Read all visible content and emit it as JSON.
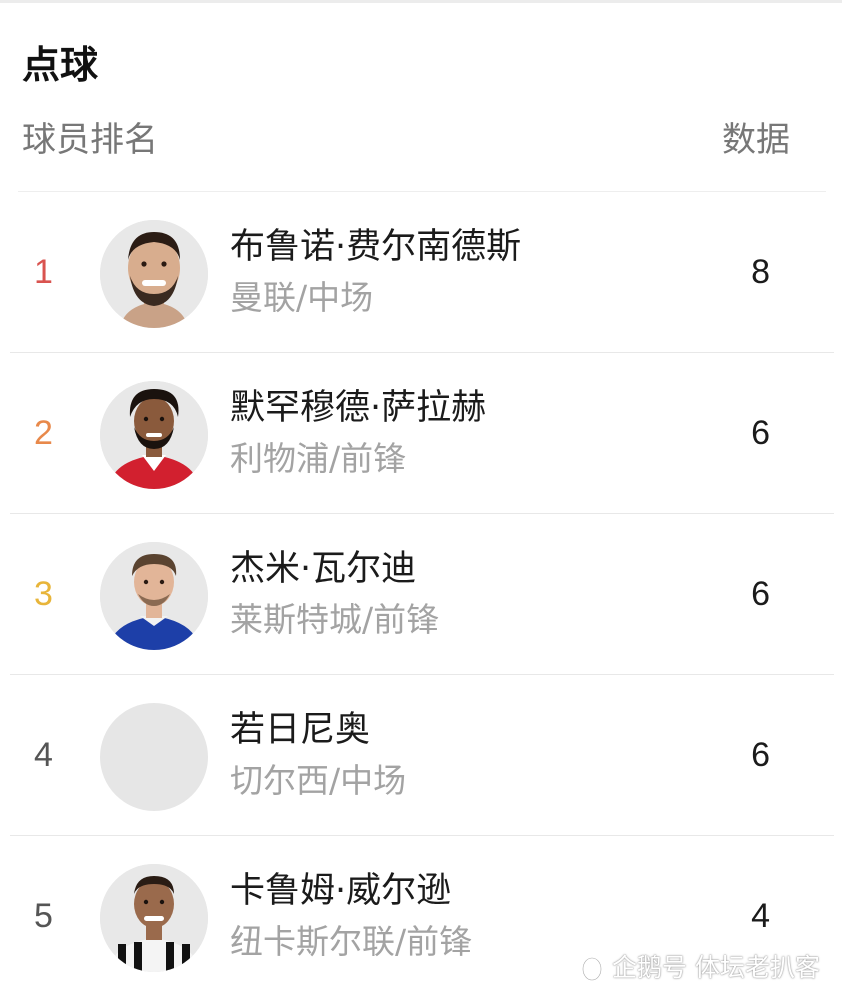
{
  "page": {
    "title": "点球",
    "header_rank": "球员排名",
    "header_data": "数据"
  },
  "players": [
    {
      "rank": "1",
      "name": "布鲁诺·费尔南德斯",
      "team": "曼联/中场",
      "value": "8",
      "rank_color": "#d9534f",
      "avatar": "player-photo-bruno"
    },
    {
      "rank": "2",
      "name": "默罕穆德·萨拉赫",
      "team": "利物浦/前锋",
      "value": "6",
      "rank_color": "#e8894b",
      "avatar": "player-photo-salah"
    },
    {
      "rank": "3",
      "name": "杰米·瓦尔迪",
      "team": "莱斯特城/前锋",
      "value": "6",
      "rank_color": "#e8b53a",
      "avatar": "player-photo-vardy"
    },
    {
      "rank": "4",
      "name": "若日尼奥",
      "team": "切尔西/中场",
      "value": "6",
      "rank_color": "#555555",
      "avatar": "placeholder"
    },
    {
      "rank": "5",
      "name": "卡鲁姆·威尔逊",
      "team": "纽卡斯尔联/前锋",
      "value": "4",
      "rank_color": "#555555",
      "avatar": "player-photo-wilson"
    }
  ],
  "watermark": "企鹅号 体坛老扒客",
  "colors": {
    "rank1": "#d9534f",
    "rank2": "#e8894b",
    "rank3": "#e8b53a",
    "rank_other": "#555555",
    "secondary_text": "#a3a3a3"
  }
}
